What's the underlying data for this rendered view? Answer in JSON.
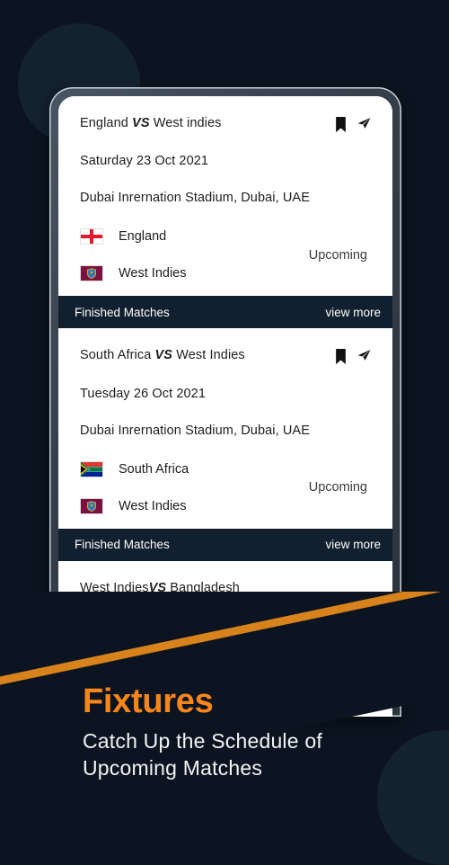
{
  "theme": {
    "background": "#0b1420",
    "circle": "#14212f",
    "accent_orange": "#f7861a",
    "stripe_orange": "#d8821c",
    "bar_dark": "#111f2e",
    "card_white": "#ffffff",
    "phone_bezel": "#39434f"
  },
  "matches": [
    {
      "title_left": "England ",
      "title_vs": "VS",
      "title_right": " West indies",
      "date": "Saturday 23 Oct 2021",
      "venue": "Dubai Inrernation Stadium, Dubai, UAE",
      "status": "Upcoming",
      "teams": [
        {
          "name": "England",
          "flag": "england-flag"
        },
        {
          "name": "West Indies",
          "flag": "west-indies-flag"
        }
      ],
      "bookmark_icon": "bookmark-icon",
      "share_icon": "send-icon"
    },
    {
      "title_left": "South Africa ",
      "title_vs": "VS",
      "title_right": " West Indies",
      "date": "Tuesday 26 Oct 2021",
      "venue": "Dubai Inrernation Stadium, Dubai, UAE",
      "status": "Upcoming",
      "teams": [
        {
          "name": "South Africa",
          "flag": "south-africa-flag"
        },
        {
          "name": "West Indies",
          "flag": "west-indies-flag"
        }
      ],
      "bookmark_icon": "bookmark-icon",
      "share_icon": "send-icon"
    },
    {
      "title_left": "West Indies",
      "title_vs": "VS",
      "title_right": " Bangladesh"
    }
  ],
  "section_bars": [
    {
      "label": "Finished Matches",
      "action": "view more"
    },
    {
      "label": "Finished Matches",
      "action": "view more"
    }
  ],
  "promo": {
    "title": "Fixtures",
    "subtitle_line1": "Catch Up the Schedule of",
    "subtitle_line2": "Upcoming Matches"
  }
}
